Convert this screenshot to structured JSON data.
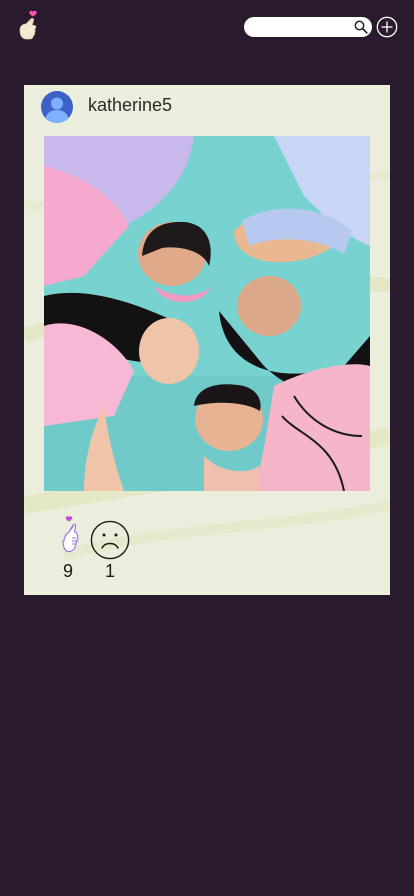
{
  "header": {
    "logo_icon": "finger-heart-icon",
    "search": {
      "placeholder": "",
      "value": "",
      "icon": "search-icon"
    },
    "add_icon": "plus-circle-icon"
  },
  "post": {
    "username": "katherine5",
    "avatar_icon": "user-avatar-icon",
    "photo_icon": "photo-image",
    "reactions": [
      {
        "icon": "finger-heart-icon",
        "count": "9"
      },
      {
        "icon": "sad-face-icon",
        "count": "1"
      }
    ]
  },
  "colors": {
    "background": "#2a1a2e",
    "card": "#eceedd",
    "accent_purple": "#9b6fe0",
    "accent_pink": "#ff4fb8",
    "avatar_blue": "#3c62c8"
  }
}
